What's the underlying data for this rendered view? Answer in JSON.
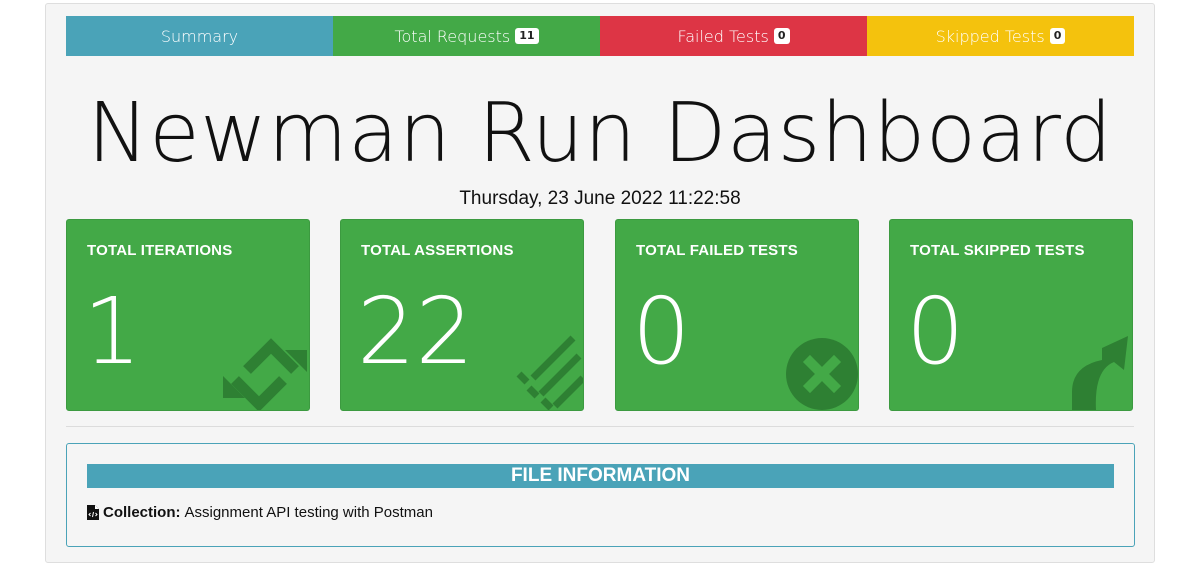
{
  "tabs": [
    {
      "label": "Summary",
      "badge": null
    },
    {
      "label": "Total Requests",
      "badge": "11"
    },
    {
      "label": "Failed Tests",
      "badge": "0"
    },
    {
      "label": "Skipped Tests",
      "badge": "0"
    }
  ],
  "title": "Newman Run Dashboard",
  "timestamp": "Thursday, 23 June 2022 11:22:58",
  "cards": [
    {
      "label": "TOTAL ITERATIONS",
      "value": "1",
      "icon": "sync-icon"
    },
    {
      "label": "TOTAL ASSERTIONS",
      "value": "22",
      "icon": "tasks-icon"
    },
    {
      "label": "TOTAL FAILED TESTS",
      "value": "0",
      "icon": "times-circle-icon"
    },
    {
      "label": "TOTAL SKIPPED TESTS",
      "value": "0",
      "icon": "share-arrow-icon"
    }
  ],
  "file_info": {
    "header": "FILE INFORMATION",
    "collection_label": "Collection:",
    "collection_value": "Assignment API testing with Postman"
  },
  "colors": {
    "summary": "#4aa3b8",
    "success": "#43a947",
    "danger": "#dd3545",
    "warning": "#f4c20d"
  }
}
